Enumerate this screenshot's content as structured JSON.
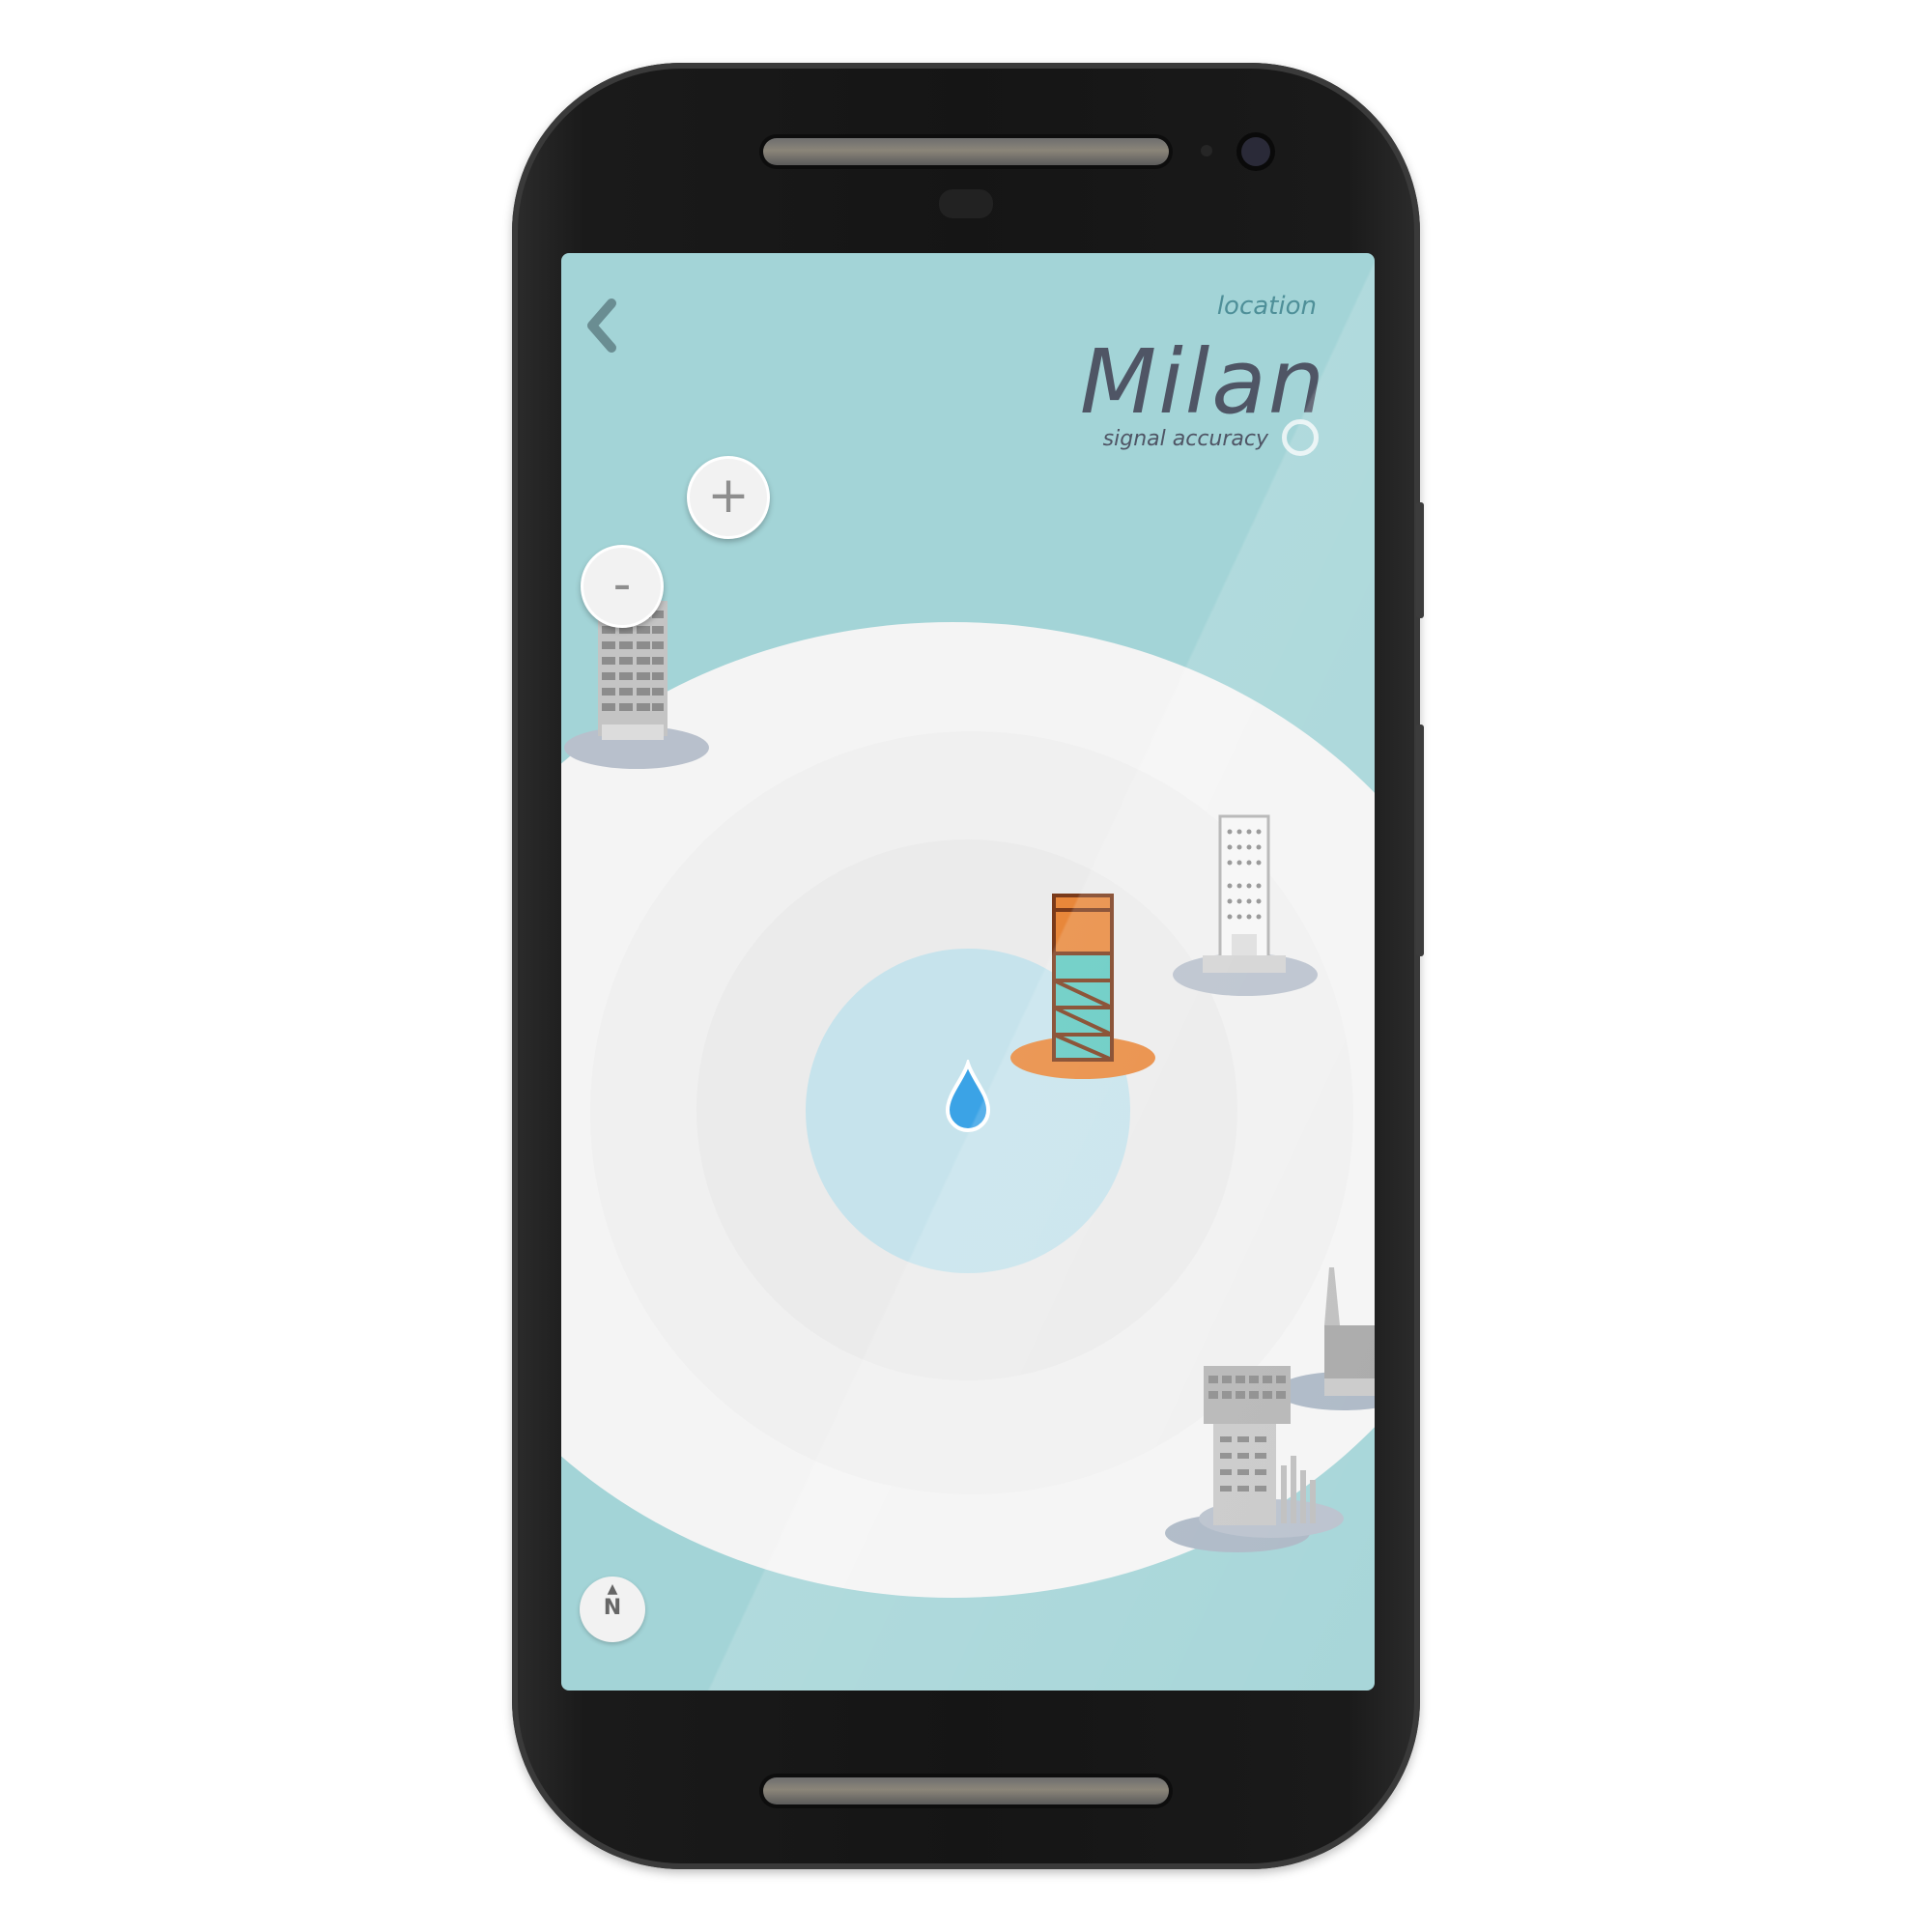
{
  "header": {
    "location_label": "location",
    "city": "Milan",
    "signal_label": "signal accuracy"
  },
  "controls": {
    "zoom_in_label": "+",
    "zoom_out_label": "-",
    "compass_label": "N"
  },
  "colors": {
    "map_background": "#a3d4d7",
    "accuracy_center": "#c6e3ec",
    "location_pin": "#3ba3e6",
    "selected_building": "#e8873a",
    "selected_building_floors": "#5fc9c0"
  },
  "icons": [
    "back-chevron-icon",
    "location-pin-icon",
    "compass-icon",
    "building-icon",
    "signal-ring-icon"
  ]
}
